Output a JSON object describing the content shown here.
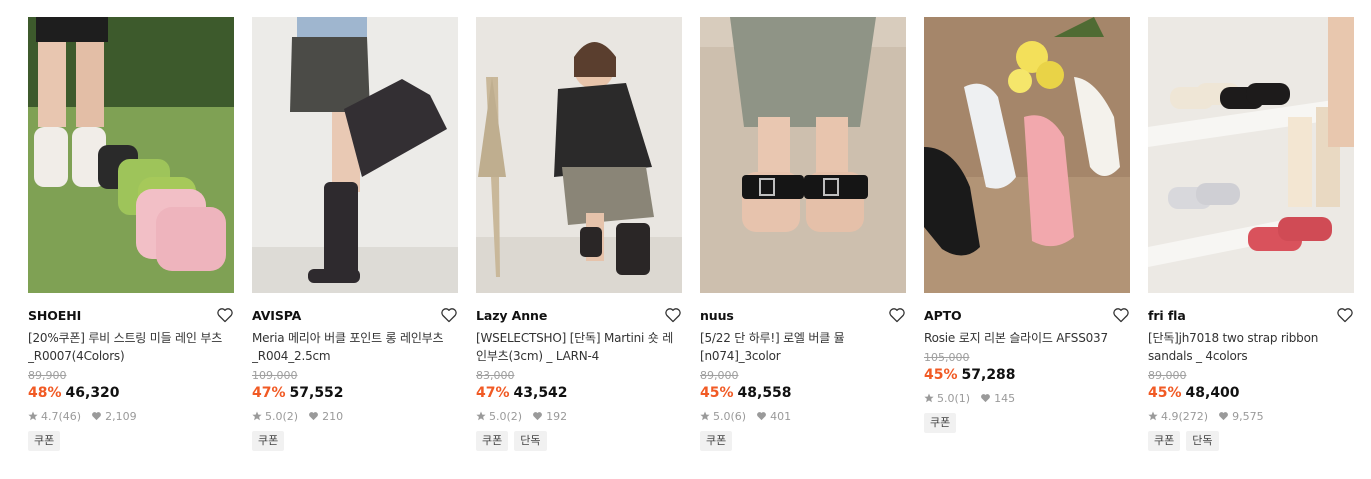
{
  "products": [
    {
      "brand": "SHOEHI",
      "title": "[20%쿠폰] 루비 스트링 미들 레인 부츠_R0007(4Colors)",
      "original_price": "89,900",
      "discount": "48%",
      "price": "46,320",
      "rating": "4.7",
      "reviews": "(46)",
      "likes": "2,109",
      "tags": [
        "쿠폰"
      ]
    },
    {
      "brand": "AVISPA",
      "title": "Meria 메리아 버클 포인트 롱 레인부츠_R004_2.5cm",
      "original_price": "109,000",
      "discount": "47%",
      "price": "57,552",
      "rating": "5.0",
      "reviews": "(2)",
      "likes": "210",
      "tags": [
        "쿠폰"
      ]
    },
    {
      "brand": "Lazy Anne",
      "title": "[WSELECTSHO] [단독] Martini 숏 레인부츠(3cm) _ LARN-4",
      "original_price": "83,000",
      "discount": "47%",
      "price": "43,542",
      "rating": "5.0",
      "reviews": "(2)",
      "likes": "192",
      "tags": [
        "쿠폰",
        "단독"
      ]
    },
    {
      "brand": "nuus",
      "title": "[5/22 단 하루!] 로엘 버클 뮬 [n074]_3color",
      "original_price": "89,000",
      "discount": "45%",
      "price": "48,558",
      "rating": "5.0",
      "reviews": "(6)",
      "likes": "401",
      "tags": [
        "쿠폰"
      ]
    },
    {
      "brand": "APTO",
      "title": "Rosie 로지 리본 슬라이드 AFSS037",
      "original_price": "105,000",
      "discount": "45%",
      "price": "57,288",
      "rating": "5.0",
      "reviews": "(1)",
      "likes": "145",
      "tags": [
        "쿠폰"
      ]
    },
    {
      "brand": "fri fla",
      "title": "[단독]jh7018 two strap ribbon sandals _ 4colors",
      "original_price": "89,000",
      "discount": "45%",
      "price": "48,400",
      "rating": "4.9",
      "reviews": "(272)",
      "likes": "9,575",
      "tags": [
        "쿠폰",
        "단독"
      ]
    }
  ],
  "icons": {
    "wishlist": "heart-outline-icon",
    "rating": "star-icon",
    "likes": "heart-filled-icon"
  },
  "colors": {
    "discount": "#f15a24",
    "original_price": "#a0a0a0",
    "meta": "#9a9a9a",
    "tag_bg": "#f1f1f1"
  }
}
